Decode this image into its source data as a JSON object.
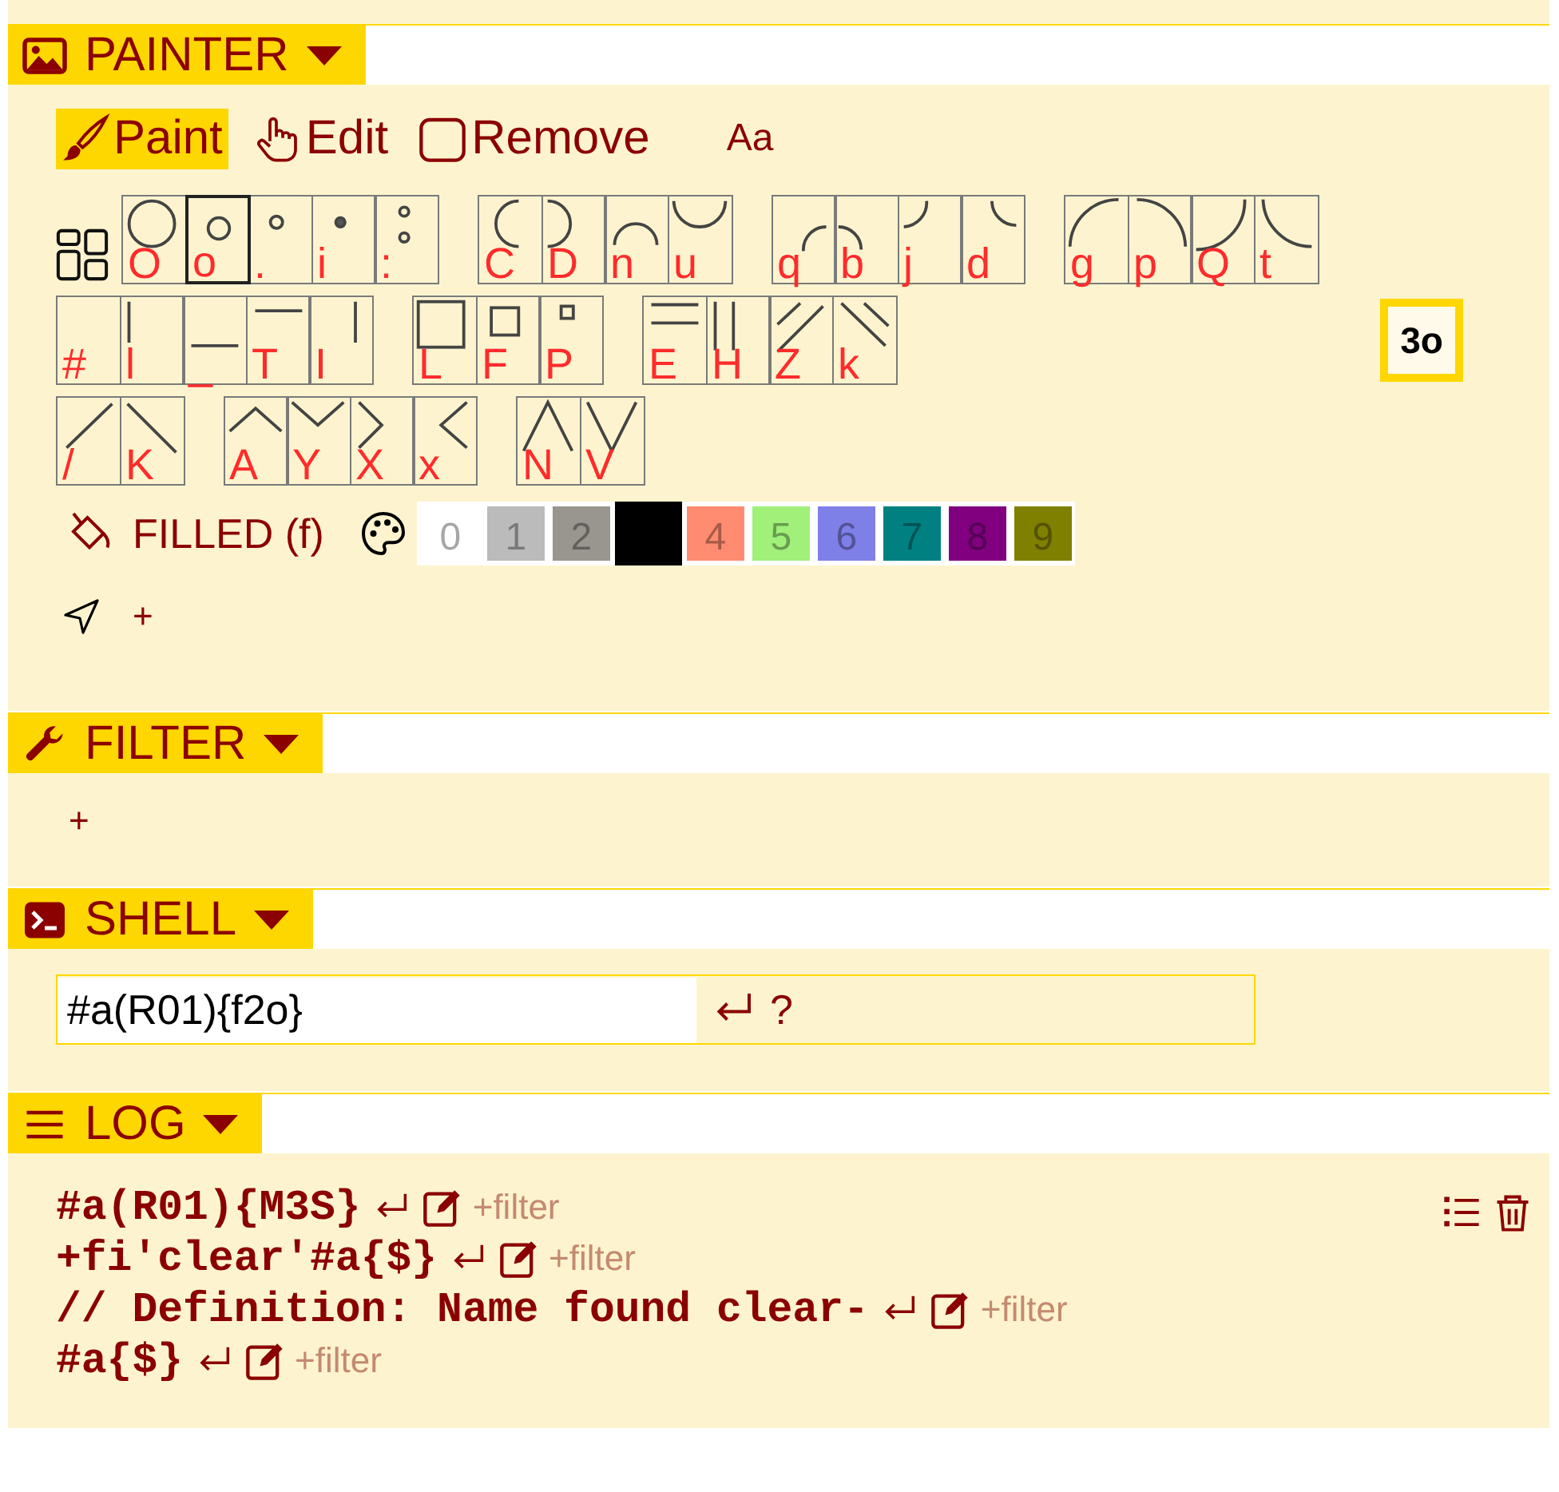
{
  "painter": {
    "header": {
      "kind": "image",
      "title": "PAINTER",
      "expanded": true
    },
    "modes": [
      {
        "kind": "brush",
        "label": "Paint",
        "selected": true
      },
      {
        "kind": "hand",
        "label": "Edit",
        "selected": false
      },
      {
        "kind": "square",
        "label": "Remove",
        "selected": false
      },
      {
        "kind": "text",
        "label": "Aa",
        "selected": false
      }
    ],
    "glyph_rows": [
      {
        "groups": [
          [
            {
              "label": "O",
              "kind": "circle-large",
              "selected": false
            },
            {
              "label": "o",
              "kind": "circle-small",
              "selected": true
            },
            {
              "label": ".",
              "kind": "ring-tiny",
              "selected": false
            },
            {
              "label": "i",
              "kind": "dot",
              "selected": false
            },
            {
              "label": ":",
              "kind": "two-rings",
              "selected": false
            }
          ],
          [
            {
              "label": "C",
              "kind": "arc-left",
              "selected": false
            },
            {
              "label": "D",
              "kind": "arc-right",
              "selected": false
            },
            {
              "label": "n",
              "kind": "arc-top",
              "selected": false
            },
            {
              "label": "u",
              "kind": "arc-bottom",
              "selected": false
            }
          ],
          [
            {
              "label": "q",
              "kind": "quarter-q",
              "selected": false
            },
            {
              "label": "b",
              "kind": "quarter-b",
              "selected": false
            },
            {
              "label": "j",
              "kind": "quarter-j",
              "selected": false
            },
            {
              "label": "d",
              "kind": "quarter-d",
              "selected": false
            }
          ],
          [
            {
              "label": "g",
              "kind": "big-g",
              "selected": false
            },
            {
              "label": "p",
              "kind": "big-p",
              "selected": false
            },
            {
              "label": "Q",
              "kind": "big-q",
              "selected": false
            },
            {
              "label": "t",
              "kind": "big-t",
              "selected": false
            }
          ]
        ]
      },
      {
        "groups": [
          [
            {
              "label": "#",
              "kind": "none",
              "selected": false
            },
            {
              "label": "l",
              "kind": "line-left",
              "selected": false
            },
            {
              "label": "_",
              "kind": "line-bottom",
              "selected": false
            },
            {
              "label": "T",
              "kind": "line-top",
              "selected": false
            },
            {
              "label": "I",
              "kind": "line-right",
              "selected": false
            }
          ],
          [
            {
              "label": "L",
              "kind": "square-large",
              "selected": false
            },
            {
              "label": "F",
              "kind": "square-medium",
              "selected": false
            },
            {
              "label": "P",
              "kind": "square-small",
              "selected": false
            }
          ],
          [
            {
              "label": "E",
              "kind": "double-horizontal",
              "selected": false
            },
            {
              "label": "H",
              "kind": "double-vertical",
              "selected": false
            },
            {
              "label": "Z",
              "kind": "double-slash",
              "selected": false
            },
            {
              "label": "k",
              "kind": "double-backslash",
              "selected": false
            }
          ]
        ]
      },
      {
        "groups": [
          [
            {
              "label": "/",
              "kind": "slash",
              "selected": false
            },
            {
              "label": "K",
              "kind": "backslash",
              "selected": false
            }
          ],
          [
            {
              "label": "A",
              "kind": "chevron-up",
              "selected": false
            },
            {
              "label": "Y",
              "kind": "chevron-down",
              "selected": false
            },
            {
              "label": "X",
              "kind": "chevron-right",
              "selected": false
            },
            {
              "label": "x",
              "kind": "chevron-left",
              "selected": false
            }
          ],
          [
            {
              "label": "N",
              "kind": "peak",
              "selected": false
            },
            {
              "label": "V",
              "kind": "valley",
              "selected": false
            }
          ]
        ]
      }
    ],
    "preview": "3o",
    "fill_label": "FILLED (f)",
    "swatches": [
      {
        "label": "0",
        "color": "#ffffff",
        "selected": false
      },
      {
        "label": "1",
        "color": "#bbbbbb",
        "selected": false
      },
      {
        "label": "2",
        "color": "#99958f",
        "selected": false
      },
      {
        "color": "#000000",
        "selected": true
      },
      {
        "label": "4",
        "color": "#ff8c70",
        "selected": false
      },
      {
        "label": "5",
        "color": "#a0f07a",
        "selected": false
      },
      {
        "label": "6",
        "color": "#7f7fe8",
        "selected": false
      },
      {
        "label": "7",
        "color": "#008080",
        "selected": false
      },
      {
        "label": "8",
        "color": "#800080",
        "selected": false
      },
      {
        "label": "9",
        "color": "#808000",
        "selected": false
      }
    ],
    "add_label": "+"
  },
  "filter": {
    "header": {
      "kind": "wrench",
      "title": "FILTER",
      "expanded": true
    },
    "add_label": "+"
  },
  "shell": {
    "header": {
      "kind": "terminal",
      "title": "SHELL",
      "expanded": true
    },
    "value": "#a(R01){f2o}",
    "help": "?"
  },
  "log": {
    "header": {
      "kind": "lines",
      "title": "LOG",
      "expanded": true
    },
    "entries": [
      {
        "text": "#a(R01){M3S}",
        "action": "+filter"
      },
      {
        "text": "+fi'clear'#a{$}",
        "action": "+filter"
      },
      {
        "text": "// Definition: Name found clear-",
        "action": "+filter"
      },
      {
        "text": "#a{$}",
        "action": "+filter"
      }
    ]
  }
}
